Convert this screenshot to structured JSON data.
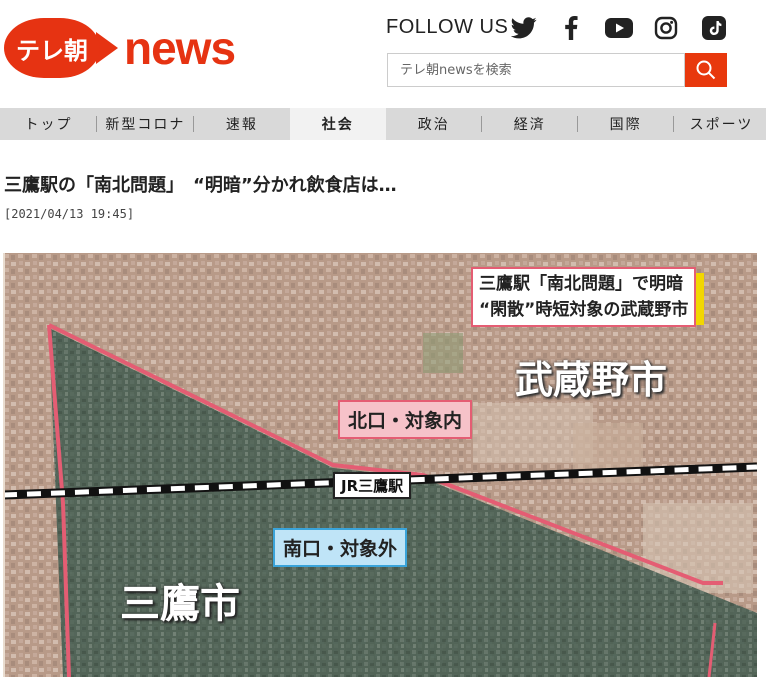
{
  "logo": {
    "text_jp": "テレ朝",
    "text_news": "news"
  },
  "follow_us": "FOLLOW US",
  "social": [
    {
      "name": "twitter-icon"
    },
    {
      "name": "facebook-icon"
    },
    {
      "name": "youtube-icon"
    },
    {
      "name": "instagram-icon"
    },
    {
      "name": "tiktok-icon"
    }
  ],
  "search": {
    "placeholder": "テレ朝newsを検索"
  },
  "nav": {
    "items": [
      {
        "label": "トップ"
      },
      {
        "label": "新型コロナ"
      },
      {
        "label": "速報"
      },
      {
        "label": "社会",
        "active": true
      },
      {
        "label": "政治"
      },
      {
        "label": "経済"
      },
      {
        "label": "国際"
      },
      {
        "label": "スポーツ"
      }
    ]
  },
  "article": {
    "title": "三鷹駅の「南北問題」　“明暗”分かれ飲食店は…",
    "date": "[2021/04/13 19:45]"
  },
  "image": {
    "caption_line1": "三鷹駅「南北問題」で明暗",
    "caption_line2": "“閑散”時短対象の武蔵野市",
    "city_north": "武蔵野市",
    "north_exit": "北口・対象内",
    "station": "JR三鷹駅",
    "south_exit": "南口・対象外",
    "city_south": "三鷹市"
  },
  "colors": {
    "brand": "#e63312",
    "search_button": "#e8380d",
    "nav_bg": "#d9d9d9",
    "nav_active": "#f2f2f2"
  }
}
